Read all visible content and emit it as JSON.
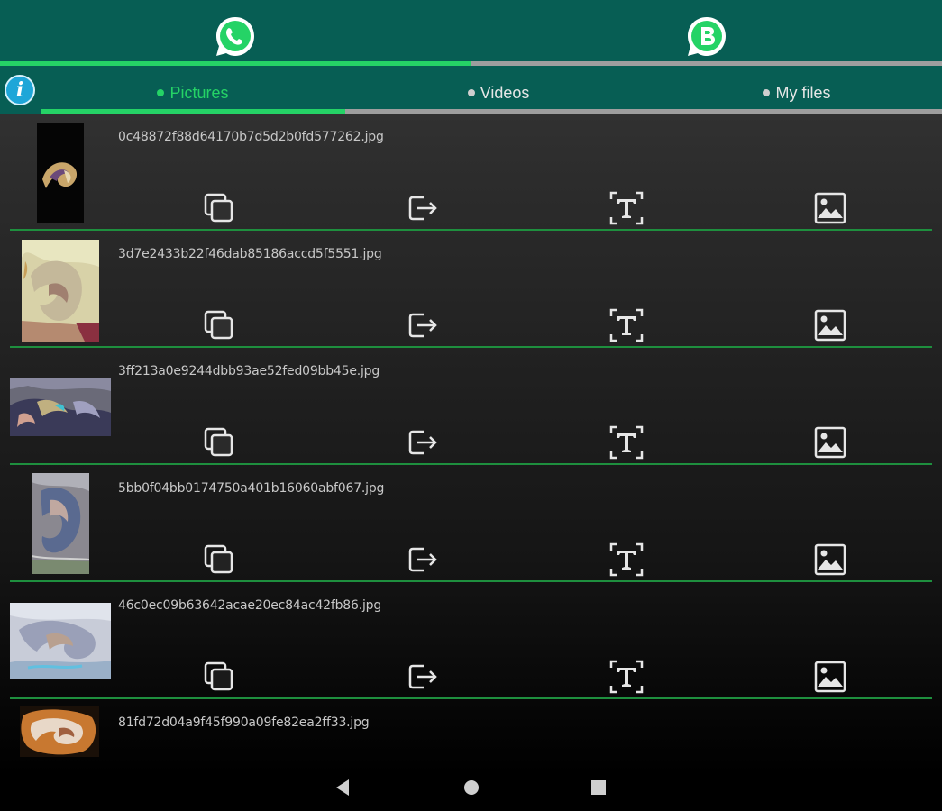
{
  "app_tabs": [
    {
      "name": "whatsapp",
      "icon": "whatsapp-icon",
      "active": true
    },
    {
      "name": "whatsapp-business",
      "icon": "whatsapp-business-icon",
      "active": false
    }
  ],
  "info_button": {
    "icon": "info-icon",
    "glyph": "i"
  },
  "sub_tabs": [
    {
      "label": "Pictures",
      "active": true
    },
    {
      "label": "Videos",
      "active": false
    },
    {
      "label": "My files",
      "active": false
    }
  ],
  "actions": [
    {
      "name": "copy",
      "icon": "copy-icon"
    },
    {
      "name": "share",
      "icon": "share-exit-icon"
    },
    {
      "name": "text",
      "icon": "text-format-icon"
    },
    {
      "name": "image",
      "icon": "image-icon"
    }
  ],
  "files": [
    {
      "filename": "0c48872f88d64170b7d5d2b0fd577262.jpg"
    },
    {
      "filename": "3d7e2433b22f46dab85186accd5f5551.jpg"
    },
    {
      "filename": "3ff213a0e9244dbb93ae52fed09bb45e.jpg"
    },
    {
      "filename": "5bb0f04bb0174750a401b16060abf067.jpg"
    },
    {
      "filename": "46c0ec09b63642acae20ec84ac42fb86.jpg"
    },
    {
      "filename": "81fd72d04a9f45f990a09fe82ea2ff33.jpg"
    }
  ],
  "colors": {
    "app_bar": "#075e54",
    "accent": "#25d366",
    "inactive_indicator": "#9e9e9e",
    "divider": "#1e8f3e",
    "info": "#1ea6d8"
  },
  "navbar": [
    {
      "name": "back",
      "icon": "back-triangle-icon"
    },
    {
      "name": "home",
      "icon": "home-circle-icon"
    },
    {
      "name": "recents",
      "icon": "recents-square-icon"
    }
  ]
}
